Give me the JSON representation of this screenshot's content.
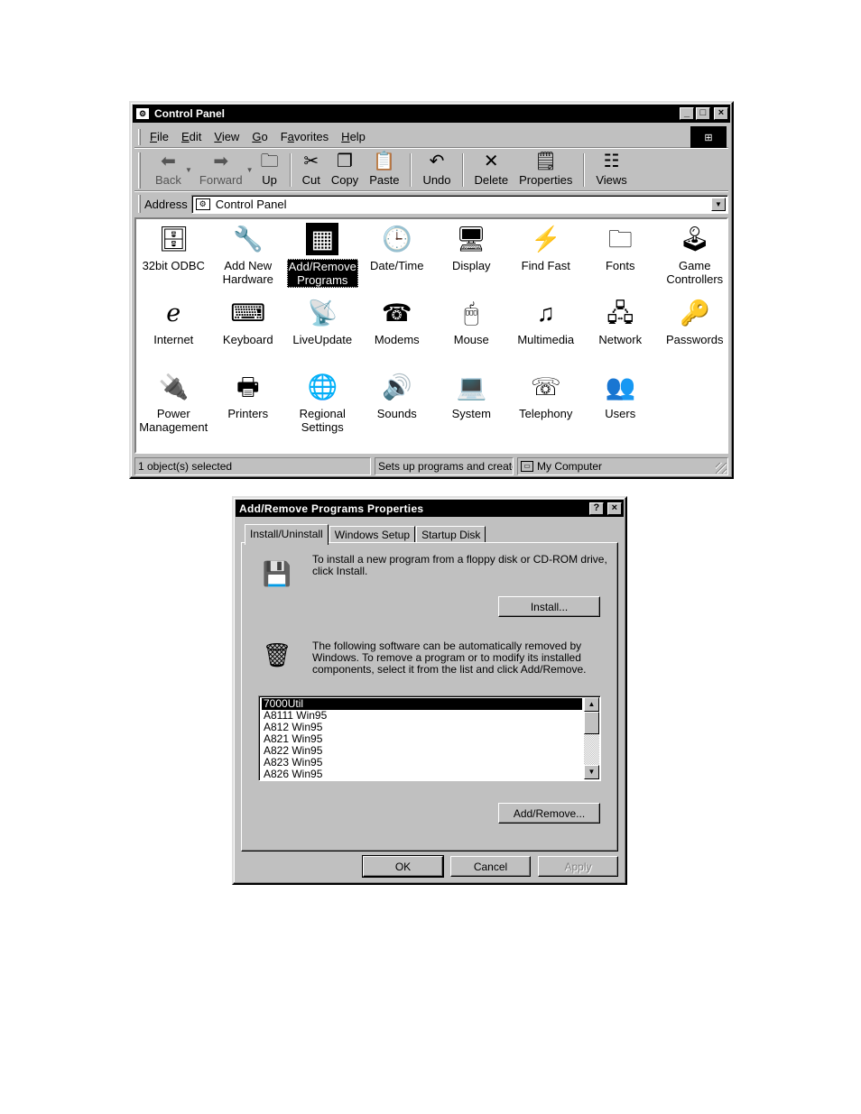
{
  "control_panel": {
    "title": "Control Panel",
    "title_buttons": [
      "_",
      "□",
      "×"
    ],
    "menu": [
      {
        "label": "File",
        "accel": "F",
        "rest": "ile"
      },
      {
        "label": "Edit",
        "accel": "E",
        "rest": "dit"
      },
      {
        "label": "View",
        "accel": "V",
        "rest": "iew"
      },
      {
        "label": "Go",
        "accel": "G",
        "rest": "o"
      },
      {
        "label": "Favorites",
        "accel": "a",
        "pre": "F",
        "rest": "vorites"
      },
      {
        "label": "Help",
        "accel": "H",
        "rest": "elp"
      }
    ],
    "toolbar": {
      "back": "Back",
      "forward": "Forward",
      "up": "Up",
      "cut": "Cut",
      "copy": "Copy",
      "paste": "Paste",
      "undo": "Undo",
      "delete": "Delete",
      "properties": "Properties",
      "views": "Views"
    },
    "address": {
      "label": "Address",
      "value": "Control Panel"
    },
    "items": [
      {
        "line1": "32bit ODBC",
        "line2": "",
        "icon": "odbc-icon",
        "glyph": "🗄"
      },
      {
        "line1": "Add New",
        "line2": "Hardware",
        "icon": "hardware-icon",
        "glyph": "🔧"
      },
      {
        "line1": "Add/Remove",
        "line2": "Programs",
        "icon": "programs-icon",
        "glyph": "▦"
      },
      {
        "line1": "Date/Time",
        "line2": "",
        "icon": "calendar-clock-icon",
        "glyph": "🕒"
      },
      {
        "line1": "Display",
        "line2": "",
        "icon": "display-icon",
        "glyph": "🖥"
      },
      {
        "line1": "Find Fast",
        "line2": "",
        "icon": "binoculars-icon",
        "glyph": "⚡"
      },
      {
        "line1": "Fonts",
        "line2": "",
        "icon": "fonts-folder-icon",
        "glyph": "🗀"
      },
      {
        "line1": "Game",
        "line2": "Controllers",
        "icon": "joystick-icon",
        "glyph": "🕹"
      },
      {
        "line1": "Internet",
        "line2": "",
        "icon": "internet-icon",
        "glyph": "ℯ"
      },
      {
        "line1": "Keyboard",
        "line2": "",
        "icon": "keyboard-icon",
        "glyph": "⌨"
      },
      {
        "line1": "LiveUpdate",
        "line2": "",
        "icon": "liveupdate-icon",
        "glyph": "📡"
      },
      {
        "line1": "Modems",
        "line2": "",
        "icon": "modem-phone-icon",
        "glyph": "☎"
      },
      {
        "line1": "Mouse",
        "line2": "",
        "icon": "mouse-icon",
        "glyph": "🖱"
      },
      {
        "line1": "Multimedia",
        "line2": "",
        "icon": "multimedia-icon",
        "glyph": "♫"
      },
      {
        "line1": "Network",
        "line2": "",
        "icon": "network-icon",
        "glyph": "🖧"
      },
      {
        "line1": "Passwords",
        "line2": "",
        "icon": "keys-icon",
        "glyph": "🔑"
      },
      {
        "line1": "Power",
        "line2": "Management",
        "icon": "power-icon",
        "glyph": "🔌"
      },
      {
        "line1": "Printers",
        "line2": "",
        "icon": "printers-folder-icon",
        "glyph": "🖶"
      },
      {
        "line1": "Regional",
        "line2": "Settings",
        "icon": "globe-icon",
        "glyph": "🌐"
      },
      {
        "line1": "Sounds",
        "line2": "",
        "icon": "speaker-icon",
        "glyph": "🔊"
      },
      {
        "line1": "System",
        "line2": "",
        "icon": "computer-icon",
        "glyph": "💻"
      },
      {
        "line1": "Telephony",
        "line2": "",
        "icon": "telephony-icon",
        "glyph": "☏"
      },
      {
        "line1": "Users",
        "line2": "",
        "icon": "users-icon",
        "glyph": "👥"
      }
    ],
    "selected_item": "Add/Remove Programs",
    "status": {
      "pane1": "1 object(s) selected",
      "pane2": "Sets up programs and create",
      "pane3": "My Computer"
    }
  },
  "dialog": {
    "title": "Add/Remove Programs Properties",
    "help_button": "?",
    "close_button": "×",
    "tabs": [
      "Install/Uninstall",
      "Windows Setup",
      "Startup Disk"
    ],
    "install_text": "To install a new program from a floppy disk or CD-ROM drive, click Install.",
    "install_button": "Install...",
    "remove_text": "The following software can be automatically removed by Windows. To remove a program or to modify its installed components, select it from the list and click Add/Remove.",
    "programs": [
      "7000Util",
      "A8111 Win95",
      "A812 Win95",
      "A821 Win95",
      "A822 Win95",
      "A823 Win95",
      "A826 Win95"
    ],
    "selected_program": "7000Util",
    "add_remove_button": "Add/Remove...",
    "ok_button": "OK",
    "cancel_button": "Cancel",
    "apply_button": "Apply"
  }
}
